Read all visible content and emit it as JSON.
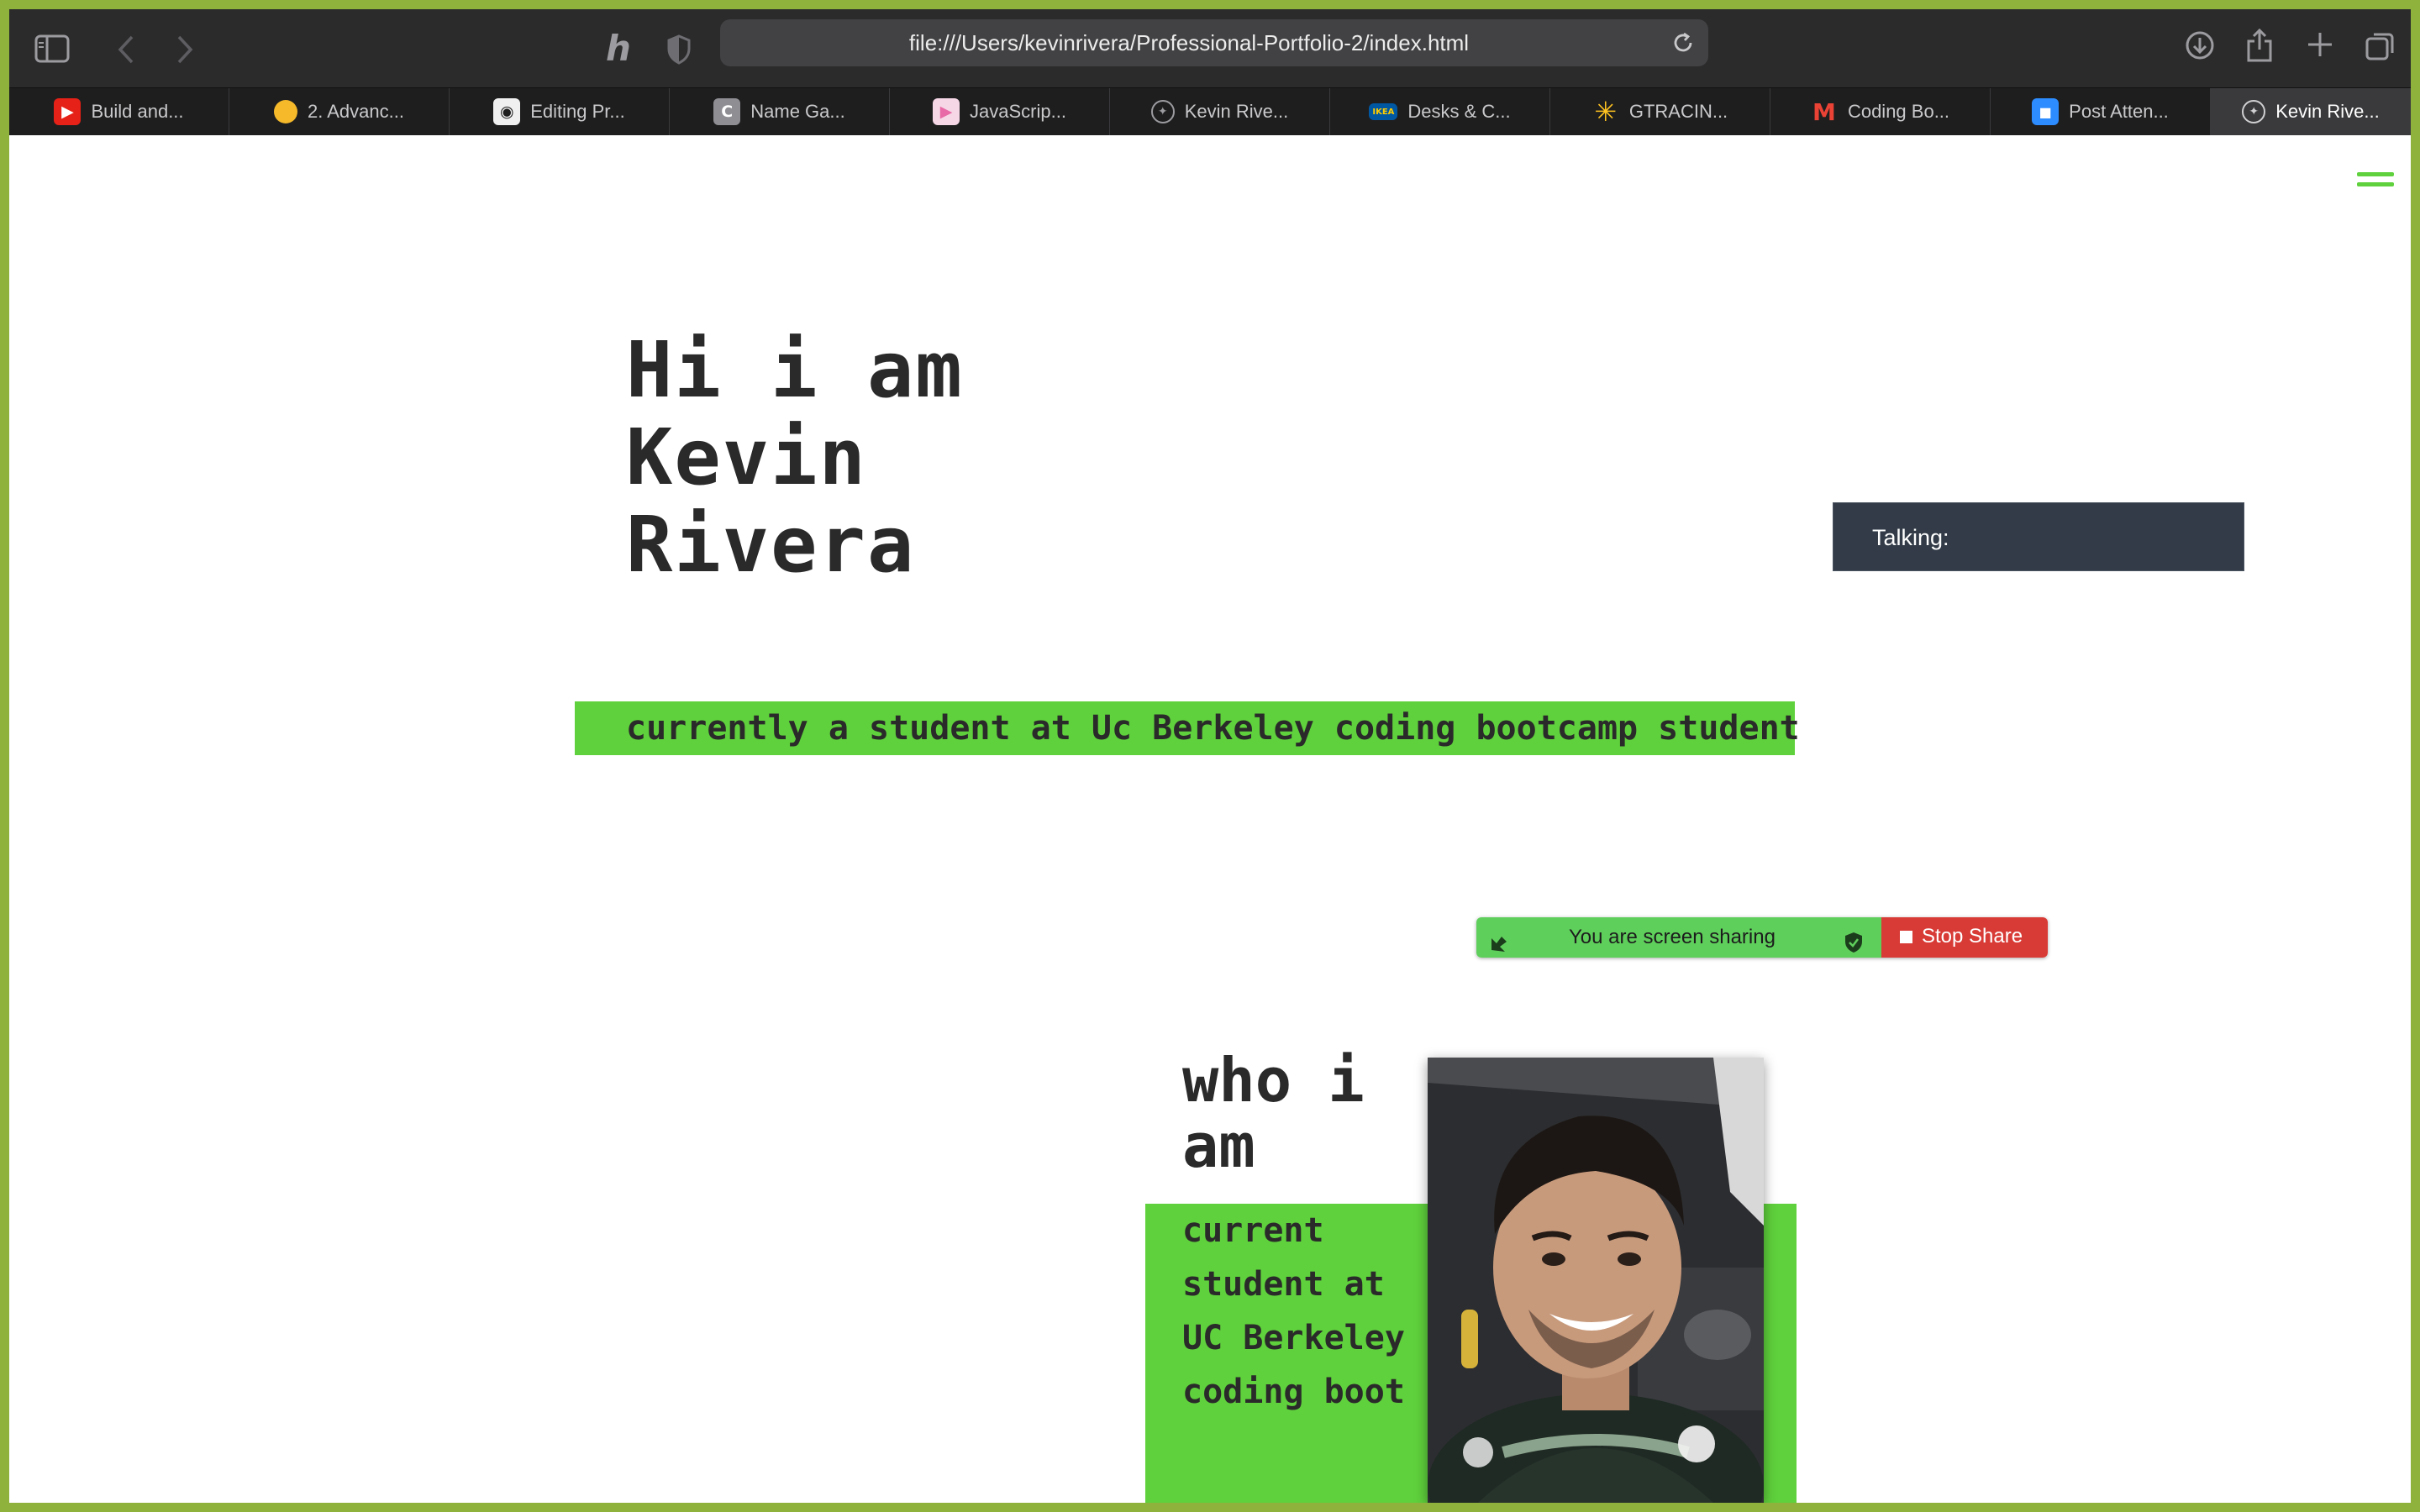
{
  "browser": {
    "url": "file:///Users/kevinrivera/Professional-Portfolio-2/index.html",
    "tabs": [
      {
        "label": "Build and...",
        "icon": "youtube-icon",
        "color": "#e62117"
      },
      {
        "label": "2. Advanc...",
        "icon": "course-icon",
        "color": "#f5b92a"
      },
      {
        "label": "Editing Pr...",
        "icon": "github-icon",
        "color": "#f0f0f0"
      },
      {
        "label": "Name Ga...",
        "icon": "c-letter-icon",
        "color": "#8e8e93"
      },
      {
        "label": "JavaScrip...",
        "icon": "play-icon",
        "color": "#e86aa6"
      },
      {
        "label": "Kevin Rive...",
        "icon": "compass-icon",
        "color": "#9c9ca0"
      },
      {
        "label": "Desks & C...",
        "icon": "ikea-icon",
        "color": "#0058a3"
      },
      {
        "label": "GTRACIN...",
        "icon": "walmart-spark-icon",
        "color": "#ffc220"
      },
      {
        "label": "Coding Bo...",
        "icon": "gmail-icon",
        "color": "#ea4335"
      },
      {
        "label": "Post Atten...",
        "icon": "zoom-video-icon",
        "color": "#2d8cff"
      },
      {
        "label": "Kevin Rive...",
        "icon": "compass-icon",
        "color": "#ffffff",
        "active": true
      }
    ]
  },
  "page": {
    "hero_title": "Hi i am Kevin Rivera",
    "hero_subtitle": "currently a student at Uc Berkeley coding bootcamp student",
    "who_title": "who i am",
    "who_text": "current student at UC Berkeley coding boot",
    "accent_color": "#5fd13c"
  },
  "overlays": {
    "talking_label": "Talking:",
    "sharing_text": "You are screen sharing",
    "stop_share_label": "Stop Share"
  }
}
